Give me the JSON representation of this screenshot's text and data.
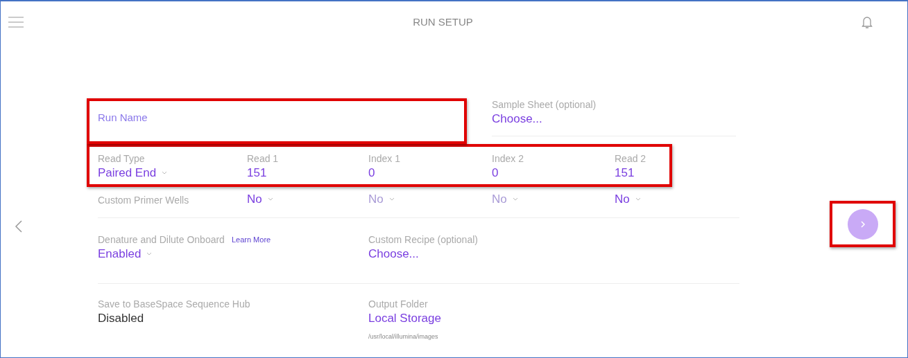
{
  "header": {
    "title": "RUN SETUP"
  },
  "run_name": {
    "placeholder": "Run Name",
    "highlighted": true
  },
  "sample_sheet": {
    "label": "Sample Sheet (optional)",
    "value": "Choose..."
  },
  "reads": {
    "highlighted": true,
    "read_type": {
      "label": "Read Type",
      "value": "Paired End"
    },
    "cycles": [
      {
        "label": "Read 1",
        "value": "151"
      },
      {
        "label": "Index 1",
        "value": "0"
      },
      {
        "label": "Index 2",
        "value": "0"
      },
      {
        "label": "Read 2",
        "value": "151"
      }
    ]
  },
  "custom_primer_wells": {
    "label": "Custom Primer Wells",
    "options": [
      {
        "value": "No",
        "disabled": false
      },
      {
        "value": "No",
        "disabled": true
      },
      {
        "value": "No",
        "disabled": true
      },
      {
        "value": "No",
        "disabled": false
      }
    ]
  },
  "denature": {
    "label": "Denature and Dilute Onboard",
    "link": "Learn More",
    "value": "Enabled"
  },
  "custom_recipe": {
    "label": "Custom Recipe (optional)",
    "value": "Choose..."
  },
  "basespace": {
    "label": "Save to BaseSpace Sequence Hub",
    "value": "Disabled"
  },
  "output_folder": {
    "label": "Output Folder",
    "value": "Local Storage",
    "path": "/usr/local/illumina/images"
  },
  "next_button": {
    "highlighted": true
  }
}
